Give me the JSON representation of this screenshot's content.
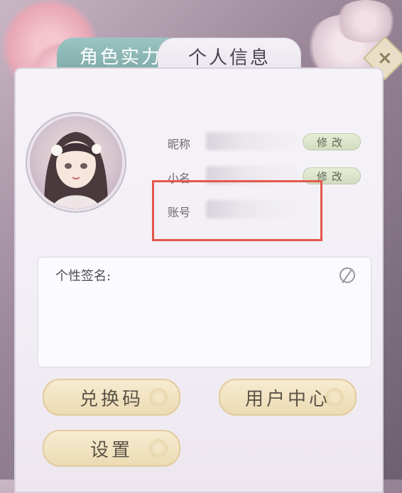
{
  "tabs": [
    {
      "label": "角色实力",
      "active": false
    },
    {
      "label": "个人信息",
      "active": true
    }
  ],
  "close_icon": "close-icon",
  "profile": {
    "nickname_label": "昵称",
    "nickname_edit": "修改",
    "alias_label": "小名",
    "alias_edit": "修改",
    "account_label": "账号"
  },
  "signature": {
    "label": "个性签名:",
    "edit_icon": "edit-icon"
  },
  "buttons": {
    "redeem": "兑换码",
    "user_center": "用户中心",
    "settings": "设置"
  },
  "colors": {
    "highlight": "#e4574a",
    "tab_inactive": "#7daaa8",
    "button_gold": "#ecdbb3"
  }
}
